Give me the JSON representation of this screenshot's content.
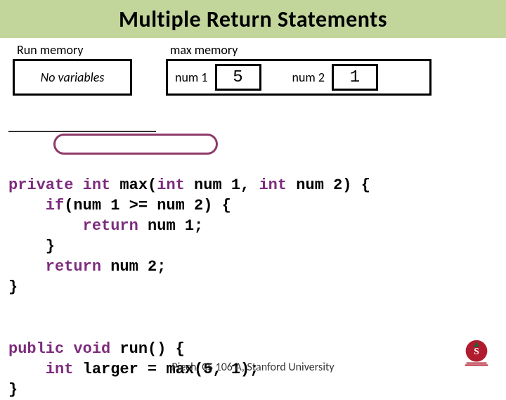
{
  "title": "Multiple Return Statements",
  "run": {
    "label": "Run memory",
    "content": "No variables"
  },
  "max": {
    "label": "max memory",
    "vars": [
      {
        "name": "num 1",
        "value": "5"
      },
      {
        "name": "num 2",
        "value": "1"
      }
    ]
  },
  "code": {
    "line1a": "private",
    "line1b": " int",
    "line1c": " max(",
    "line1d": "int",
    "line1e": " num 1, ",
    "line1f": "int",
    "line1g": " num 2) {",
    "line2a": "    if",
    "line2b": "(num 1 >= num 2) {",
    "line3a": "        return",
    "line3b": " num 1;",
    "line4": "    }",
    "line5a": "    return",
    "line5b": " num 2;",
    "line6": "}",
    "line7a": "public",
    "line7b": " void",
    "line7c": " run() {",
    "line8a": "    int",
    "line8b": " larger = max(5, 1);",
    "line9": "}"
  },
  "footer": "Piech, CS 106 A, Stanford University"
}
